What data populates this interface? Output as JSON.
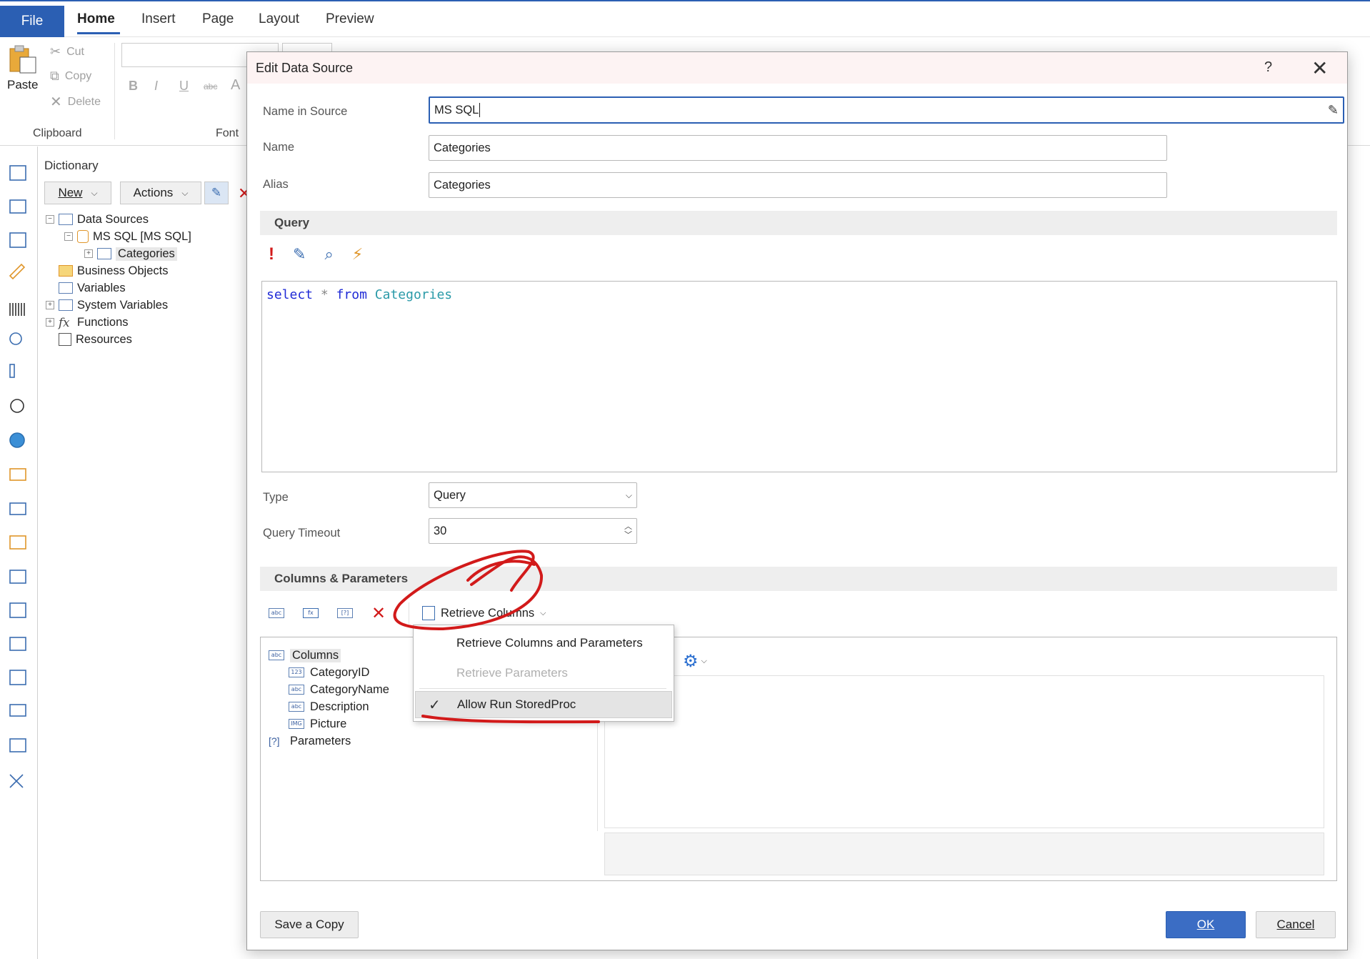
{
  "ribbon": {
    "tabs": [
      "File",
      "Home",
      "Insert",
      "Page",
      "Layout",
      "Preview"
    ],
    "clipboard": {
      "paste": "Paste",
      "cut": "Cut",
      "copy": "Copy",
      "delete": "Delete",
      "group_label": "Clipboard"
    },
    "font": {
      "group_label": "Font",
      "bold": "B",
      "italic": "I",
      "underline": "U",
      "strike": "abc",
      "color": "A"
    }
  },
  "dictionary": {
    "title": "Dictionary",
    "new_label": "New",
    "actions_label": "Actions",
    "tree": [
      "Data Sources",
      "MS SQL [MS SQL]",
      "Categories",
      "Business Objects",
      "Variables",
      "System Variables",
      "Functions",
      "Resources"
    ]
  },
  "dialog": {
    "title": "Edit Data Source",
    "help": "?",
    "close": "✕",
    "name_in_source_label": "Name in Source",
    "name_in_source_value": "MS SQL",
    "name_label": "Name",
    "name_value": "Categories",
    "alias_label": "Alias",
    "alias_value": "Categories",
    "query_header": "Query",
    "query_tokens": {
      "select": "select",
      "star": "*",
      "from": "from",
      "table": "Categories"
    },
    "type_label": "Type",
    "type_value": "Query",
    "timeout_label": "Query Timeout",
    "timeout_value": "30",
    "columns_header": "Columns & Parameters",
    "retrieve_columns": "Retrieve Columns",
    "columns_tree": {
      "columns": "Columns",
      "items": [
        "CategoryID",
        "CategoryName",
        "Description",
        "Picture"
      ],
      "item_icons": [
        "123",
        "abc",
        "abc",
        "IMG"
      ],
      "parameters": "Parameters"
    },
    "menu": {
      "item1": "Retrieve Columns and Parameters",
      "item2": "Retrieve Parameters",
      "item3": "Allow Run StoredProc",
      "check": "✓"
    },
    "save_copy": "Save a Copy",
    "ok": "OK",
    "cancel": "Cancel"
  }
}
